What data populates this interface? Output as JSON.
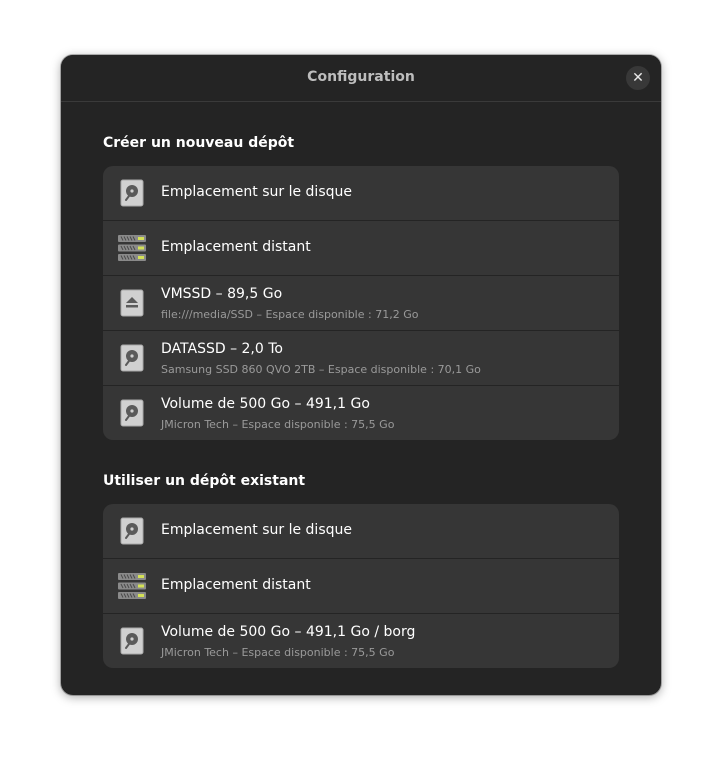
{
  "dialog": {
    "title": "Configuration",
    "close_glyph": "✕"
  },
  "create_section": {
    "title": "Créer un nouveau dépôt",
    "items": [
      {
        "label": "Emplacement sur le disque",
        "subtitle": "",
        "icon": "drive-harddisk-icon"
      },
      {
        "label": "Emplacement distant",
        "subtitle": "",
        "icon": "network-server-icon"
      },
      {
        "label": "VMSSD – 89,5 Go",
        "subtitle": "file:///media/SSD – Espace disponible : 71,2 Go",
        "icon": "eject-drive-icon"
      },
      {
        "label": "DATASSD – 2,0 To",
        "subtitle": "Samsung SSD 860 QVO 2TB – Espace disponible : 70,1 Go",
        "icon": "drive-harddisk-icon"
      },
      {
        "label": "Volume de 500 Go – 491,1 Go",
        "subtitle": "JMicron Tech – Espace disponible : 75,5 Go",
        "icon": "drive-harddisk-icon"
      }
    ]
  },
  "existing_section": {
    "title": "Utiliser un dépôt existant",
    "items": [
      {
        "label": "Emplacement sur le disque",
        "subtitle": "",
        "icon": "drive-harddisk-icon"
      },
      {
        "label": "Emplacement distant",
        "subtitle": "",
        "icon": "network-server-icon"
      },
      {
        "label": "Volume de 500 Go – 491,1 Go / borg",
        "subtitle": "JMicron Tech – Espace disponible : 75,5 Go",
        "icon": "drive-harddisk-icon"
      }
    ]
  },
  "colors": {
    "dialog_bg": "#242424",
    "row_bg": "#363636",
    "text_primary": "#ffffff",
    "text_secondary": "#9a9a9a",
    "server_led": "#d4e157"
  }
}
